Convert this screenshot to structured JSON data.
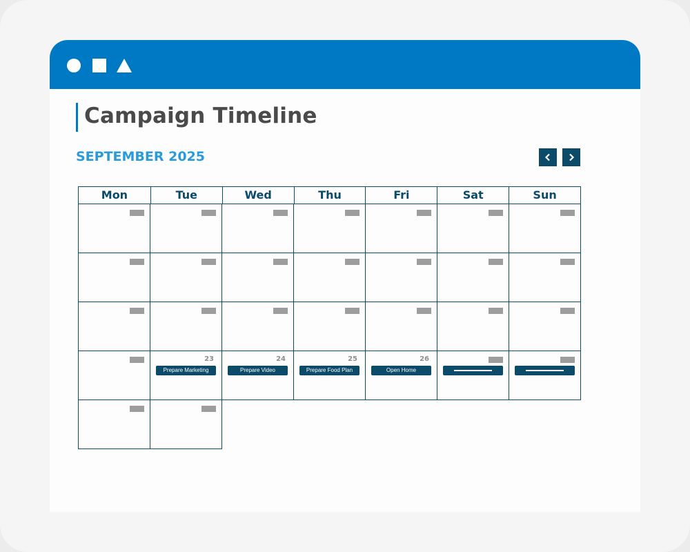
{
  "window": {
    "title_shapes": [
      "circle-icon",
      "square-icon",
      "triangle-icon"
    ],
    "accent_color": "#0079c5",
    "dark_color": "#0b4a68"
  },
  "header": {
    "title": "Campaign Timeline",
    "month": "SEPTEMBER 2025",
    "prev_icon": "chevron-left-icon",
    "next_icon": "chevron-right-icon"
  },
  "calendar": {
    "weekdays": [
      "Mon",
      "Tue",
      "Wed",
      "Thu",
      "Fri",
      "Sat",
      "Sun"
    ],
    "weeks": [
      [
        {
          "date": ""
        },
        {
          "date": ""
        },
        {
          "date": ""
        },
        {
          "date": ""
        },
        {
          "date": ""
        },
        {
          "date": ""
        },
        {
          "date": ""
        }
      ],
      [
        {
          "date": ""
        },
        {
          "date": ""
        },
        {
          "date": ""
        },
        {
          "date": ""
        },
        {
          "date": ""
        },
        {
          "date": ""
        },
        {
          "date": ""
        }
      ],
      [
        {
          "date": ""
        },
        {
          "date": ""
        },
        {
          "date": ""
        },
        {
          "date": ""
        },
        {
          "date": ""
        },
        {
          "date": ""
        },
        {
          "date": ""
        }
      ],
      [
        {
          "date": ""
        },
        {
          "date": "23",
          "event": "Prepare Marketing"
        },
        {
          "date": "24",
          "event": "Prepare Video"
        },
        {
          "date": "25",
          "event": "Prepare Food Plan"
        },
        {
          "date": "26",
          "event": "Open Home"
        },
        {
          "date": "",
          "event": ""
        },
        {
          "date": "",
          "event": ""
        }
      ],
      [
        {
          "date": ""
        },
        {
          "date": ""
        }
      ]
    ]
  }
}
